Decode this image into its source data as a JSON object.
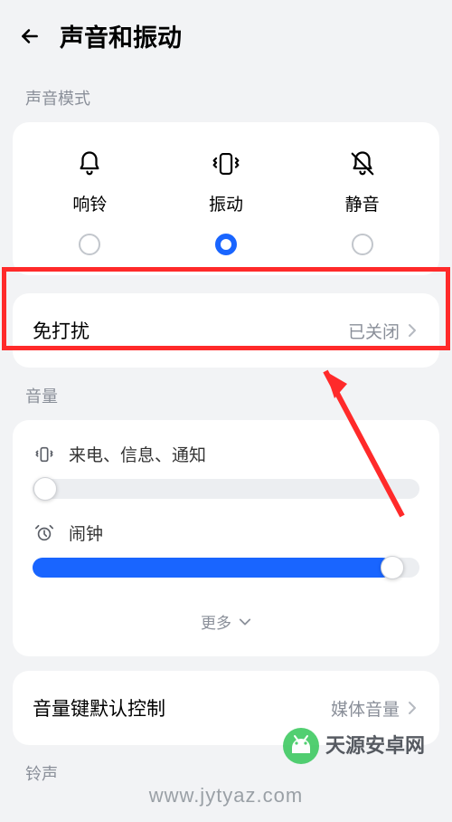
{
  "header": {
    "title": "声音和振动"
  },
  "sections": {
    "sound_mode": "声音模式",
    "volume": "音量",
    "ringtone": "铃声"
  },
  "modes": {
    "ring": "响铃",
    "vibrate": "振动",
    "silent": "静音",
    "selected": "vibrate"
  },
  "dnd": {
    "title": "免打扰",
    "value": "已关闭"
  },
  "volumes": {
    "calls": {
      "label": "来电、信息、通知",
      "percent": 3
    },
    "alarm": {
      "label": "闹钟",
      "percent": 93
    }
  },
  "more": "更多",
  "vol_key": {
    "title": "音量键默认控制",
    "value": "媒体音量"
  },
  "watermark": {
    "brand": "天源安卓网",
    "url": "www.jytyaz.com"
  }
}
